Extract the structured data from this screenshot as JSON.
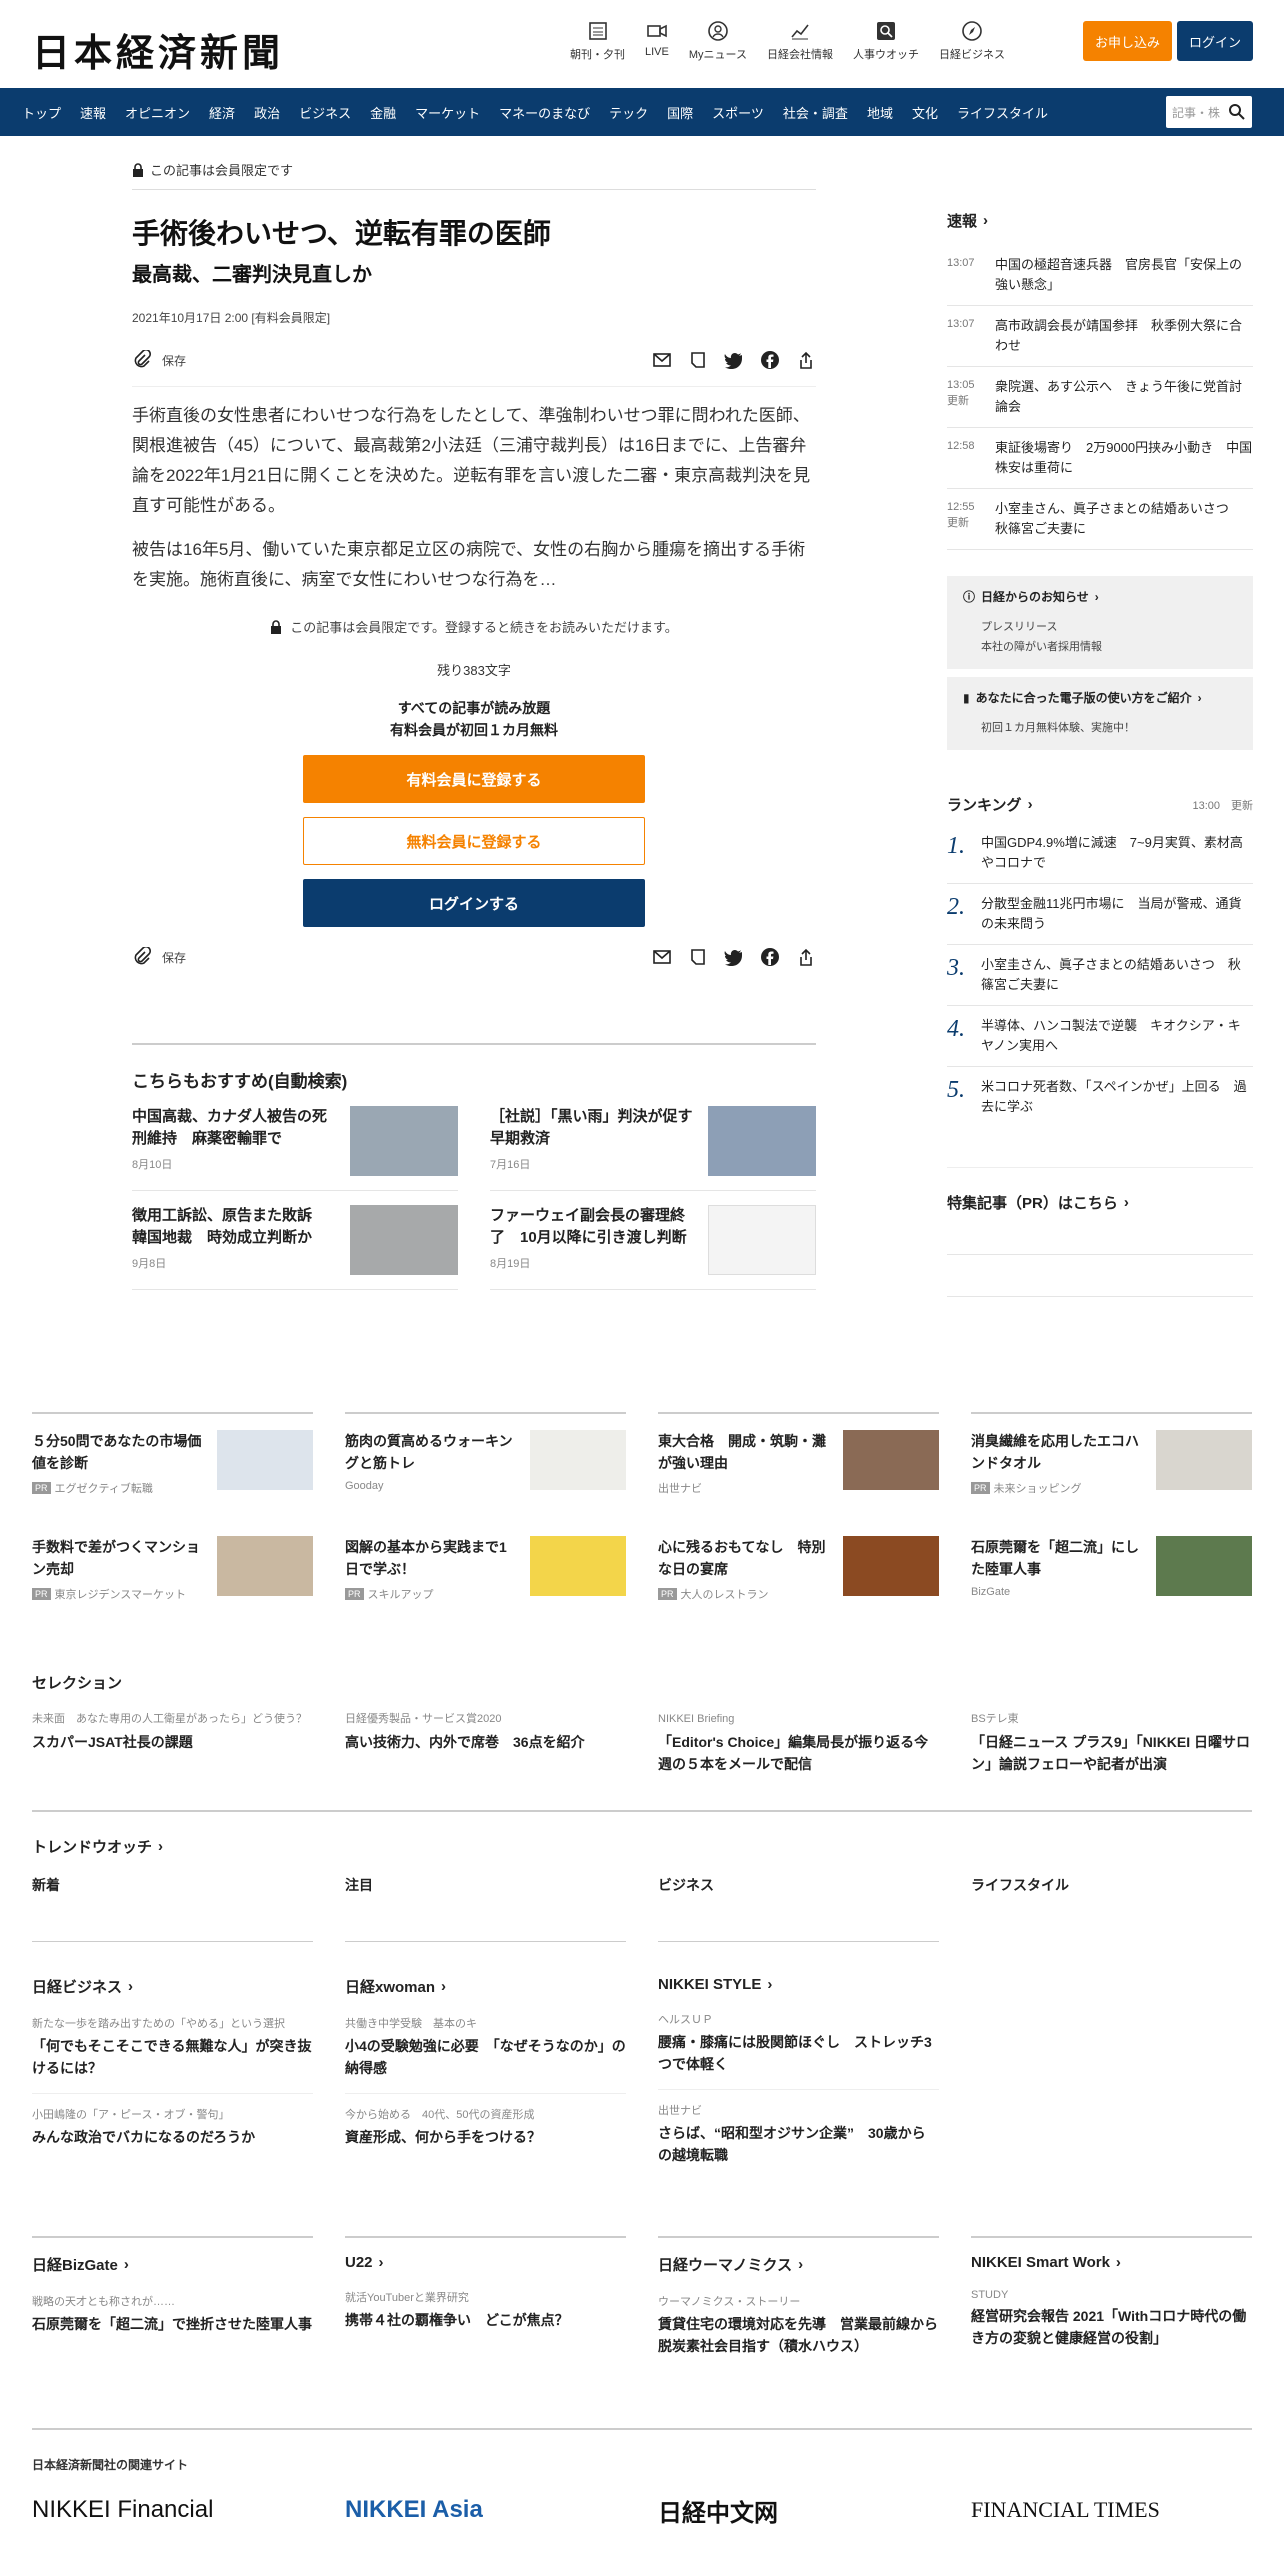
{
  "header": {
    "logo": "日本経済新聞",
    "icons": [
      {
        "label": "朝刊・夕刊",
        "icon": "newspaper-icon"
      },
      {
        "label": "LIVE",
        "icon": "video-icon"
      },
      {
        "label": "Myニュース",
        "icon": "user-icon"
      },
      {
        "label": "日経会社情報",
        "icon": "chart-icon"
      },
      {
        "label": "人事ウオッチ",
        "icon": "search-person-icon"
      },
      {
        "label": "日経ビジネス",
        "icon": "compass-icon"
      }
    ],
    "subscribe": "お申し込み",
    "login": "ログイン"
  },
  "nav": {
    "items": [
      "トップ",
      "速報",
      "オピニオン",
      "経済",
      "政治",
      "ビジネス",
      "金融",
      "マーケット",
      "マネーのまなび",
      "テック",
      "国際",
      "スポーツ",
      "社会・調査",
      "地域",
      "文化",
      "ライフスタイル"
    ],
    "search_placeholder": "記事・株"
  },
  "article": {
    "members_only": "この記事は会員限定です",
    "title": "手術後わいせつ、逆転有罪の医師",
    "subtitle": "最高裁、二審判決見直しか",
    "date": "2021年10月17日 2:00 [有料会員限定]",
    "save": "保存",
    "p1": "手術直後の女性患者にわいせつな行為をしたとして、準強制わいせつ罪に問われた医師、関根進被告（45）について、最高裁第2小法廷（三浦守裁判長）は16日までに、上告審弁論を2022年1月21日に開くことを決めた。逆転有罪を言い渡した二審・東京高裁判決を見直す可能性がある。",
    "p2": "被告は16年5月、働いていた東京都足立区の病院で、女性の右胸から腫瘍を摘出する手術を実施。施術直後に、病室で女性にわいせつな行為を…",
    "locked": "この記事は会員限定です。登録すると続きをお読みいただけます。",
    "remaining": "残り383文字",
    "promo1": "すべての記事が読み放題",
    "promo2": "有料会員が初回１カ月無料",
    "cta_paid": "有料会員に登録する",
    "cta_free": "無料会員に登録する",
    "cta_login": "ログインする"
  },
  "recommend": {
    "title": "こちらもおすすめ(自動検索)",
    "items": [
      {
        "title": "中国高裁、カナダ人被告の死刑維持　麻薬密輸罪で",
        "date": "8月10日"
      },
      {
        "title": "［社説］「黒い雨」判決が促す早期救済",
        "date": "7月16日"
      },
      {
        "title": "徴用工訴訟、原告また敗訴　韓国地裁　時効成立判断か",
        "date": "9月8日"
      },
      {
        "title": "ファーウェイ副会長の審理終了　10月以降に引き渡し判断",
        "date": "8月19日"
      }
    ]
  },
  "sidebar": {
    "breaking_title": "速報",
    "news": [
      {
        "time": "13:07",
        "title": "中国の極超音速兵器　官房長官「安保上の強い懸念」"
      },
      {
        "time": "13:07",
        "title": "高市政調会長が靖国参拝　秋季例大祭に合わせ"
      },
      {
        "time": "13:05\n更新",
        "title": "衆院選、あす公示へ　きょう午後に党首討論会"
      },
      {
        "time": "12:58",
        "title": "東証後場寄り　2万9000円挟み小動き　中国株安は重荷に"
      },
      {
        "time": "12:55\n更新",
        "title": "小室圭さん、眞子さまとの結婚あいさつ　秋篠宮ご夫妻に"
      }
    ],
    "info_title": "日経からのお知らせ",
    "info_items": [
      "プレスリリース",
      "本社の障がい者採用情報"
    ],
    "digital_title": "あなたに合った電子版の使い方をご紹介",
    "digital_items": [
      "初回１カ月無料体験、実施中！"
    ],
    "ranking_title": "ランキング",
    "ranking_time": "13:00　更新",
    "ranking": [
      {
        "n": "1.",
        "title": "中国GDP4.9%増に減速　7~9月実質、素材高やコロナで"
      },
      {
        "n": "2.",
        "title": "分散型金融11兆円市場に　当局が警戒、通貨の未来問う"
      },
      {
        "n": "3.",
        "title": "小室圭さん、眞子さまとの結婚あいさつ　秋篠宮ご夫妻に"
      },
      {
        "n": "4.",
        "title": "半導体、ハンコ製法で逆襲　キオクシア・キヤノン実用へ"
      },
      {
        "n": "5.",
        "title": "米コロナ死者数、「スペインかぜ」上回る　過去に学ぶ"
      }
    ],
    "feature_title": "特集記事（PR）はこちら"
  },
  "ads": [
    {
      "title": "５分50問であなたの市場価値を診断",
      "source": "エグゼクティブ転職",
      "pr": true
    },
    {
      "title": "筋肉の質高めるウォーキングと筋トレ",
      "source": "Gooday",
      "pr": false
    },
    {
      "title": "東大合格　開成・筑駒・灘が強い理由",
      "source": "出世ナビ",
      "pr": false
    },
    {
      "title": "消臭繊維を応用したエコハンドタオル",
      "source": "未来ショッピング",
      "pr": true
    },
    {
      "title": "手数料で差がつくマンション売却",
      "source": "東京レジデンスマーケット",
      "pr": true
    },
    {
      "title": "図解の基本から実践まで1日で学ぶ！",
      "source": "スキルアップ",
      "pr": true
    },
    {
      "title": "心に残るおもてなし　特別な日の宴席",
      "source": "大人のレストラン",
      "pr": true
    },
    {
      "title": "石原莞爾を「超二流」にした陸軍人事",
      "source": "BizGate",
      "pr": false
    }
  ],
  "selection": {
    "title": "セレクション",
    "items": [
      {
        "cat": "未来面　あなた専用の人工衛星があったら」どう使う？",
        "title": "スカパーJSAT社長の課題"
      },
      {
        "cat": "日経優秀製品・サービス賞2020",
        "title": "高い技術力、内外で席巻　36点を紹介"
      },
      {
        "cat": "NIKKEI Briefing",
        "title": "「Editor's Choice」編集局長が振り返る今週の５本をメールで配信"
      },
      {
        "cat": "BSテレ東",
        "title": "「日経ニュース プラス9」「NIKKEI 日曜サロン」論説フェローや記者が出演"
      }
    ]
  },
  "trend": {
    "title": "トレンドウオッチ",
    "cols": [
      "新着",
      "注目",
      "ビジネス",
      "ライフスタイル"
    ]
  },
  "media1": [
    {
      "head": "日経ビジネス",
      "c1": "新たな一歩を踏み出すための「やめる」という選択",
      "t1": "「何でもそこそこできる無難な人」が突き抜けるには？",
      "c2": "小田嶋隆の「ア・ピース・オブ・警句」",
      "t2": "みんな政治でバカになるのだろうか"
    },
    {
      "head": "日経xwoman",
      "c1": "共働き中学受験　基本のキ",
      "t1": "小4の受験勉強に必要　「なぜそうなのか」の納得感",
      "c2": "今から始める　40代、50代の資産形成",
      "t2": "資産形成、何から手をつける？"
    },
    {
      "head": "NIKKEI STYLE",
      "c1": "ヘルスＵＰ",
      "t1": "腰痛・膝痛には股関節ほぐし　ストレッチ3つで体軽く",
      "c2": "出世ナビ",
      "t2": "さらば、“昭和型オジサン企業”　30歳からの越境転職"
    }
  ],
  "media2": [
    {
      "head": "日経BizGate",
      "c1": "戦略の天才とも称されが……",
      "t1": "石原莞爾を「超二流」で挫折させた陸軍人事"
    },
    {
      "head": "U22",
      "c1": "就活YouTuberと業界研究",
      "t1": "携帯４社の覇権争い　どこが焦点？"
    },
    {
      "head": "日経ウーマノミクス",
      "c1": "ウーマノミクス・ストーリー",
      "t1": "賃貸住宅の環境対応を先導　営業最前線から脱炭素社会目指す（積水ハウス）"
    },
    {
      "head": "NIKKEI Smart Work",
      "c1": "STUDY",
      "t1": "経営研究会報告 2021「Withコロナ時代の働き方の変貌と健康経営の役割」"
    }
  ],
  "related": {
    "title": "日本経済新聞社の関連サイト",
    "brands": [
      "NIKKEI Financial",
      "NIKKEI Asia",
      "日経中文网",
      "FINANCIAL TIMES"
    ]
  }
}
